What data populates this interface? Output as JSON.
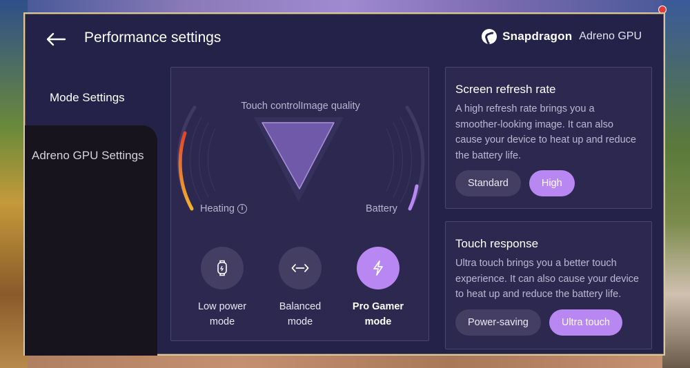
{
  "header": {
    "title": "Performance settings",
    "brand_name": "Snapdragon",
    "brand_sub": "Adreno GPU"
  },
  "sidebar": {
    "items": [
      {
        "label": "Mode Settings",
        "active": true
      },
      {
        "label": "Adreno GPU Settings",
        "active": false
      }
    ]
  },
  "triangle": {
    "top_label": "Touch controlImage quality",
    "left_label": "Heating",
    "right_label": "Battery"
  },
  "modes": [
    {
      "line1": "Low power",
      "line2": "mode",
      "icon": "watch-icon",
      "selected": false
    },
    {
      "line1": "Balanced",
      "line2": "mode",
      "icon": "balance-arrows-icon",
      "selected": false
    },
    {
      "line1": "Pro Gamer",
      "line2": "mode",
      "icon": "lightning-icon",
      "selected": true
    }
  ],
  "refresh": {
    "title": "Screen refresh rate",
    "description": "A high refresh rate brings you a smoother-looking image. It can also cause your device to heat up and reduce the battery life.",
    "options": [
      {
        "label": "Standard",
        "selected": false
      },
      {
        "label": "High",
        "selected": true
      }
    ]
  },
  "touch": {
    "title": "Touch response",
    "description": "Ultra touch brings you a better touch experience. It can also cause your device to heat up and reduce the battery life.",
    "options": [
      {
        "label": "Power-saving",
        "selected": false
      },
      {
        "label": "Ultra touch",
        "selected": true
      }
    ]
  },
  "colors": {
    "panel_bg": "#25224a",
    "card_bg": "#2d2850",
    "accent": "#b987f2",
    "pill_bg": "#433e62",
    "heat_gauge_top": "#e0442c",
    "heat_gauge_bottom": "#f4b22c",
    "battery_gauge": "#b987f2"
  }
}
